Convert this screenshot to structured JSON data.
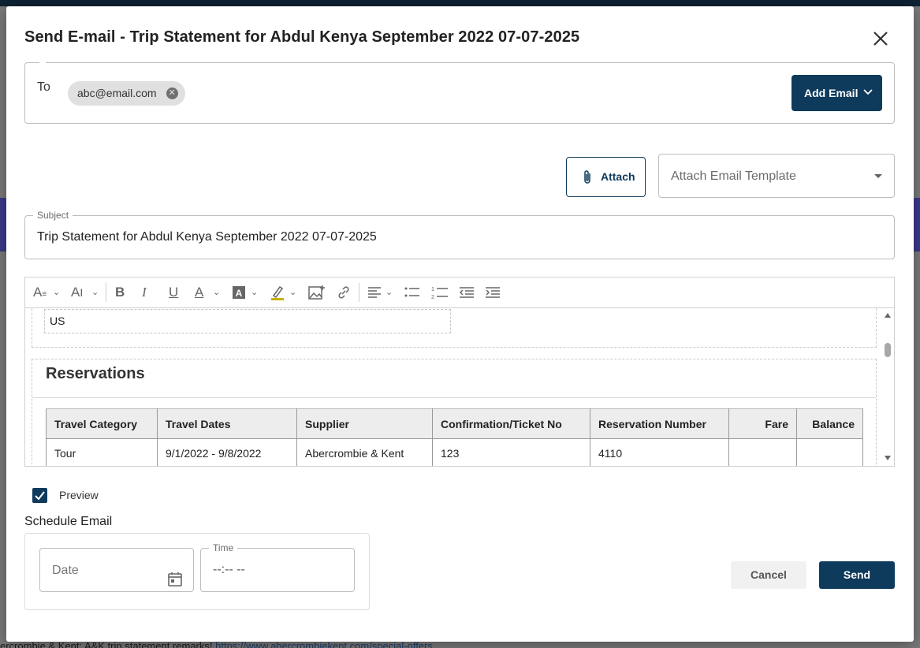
{
  "background": {
    "bottom_text": "ercrombie & Kent: A&K trip statement remarks!",
    "bottom_link": "https://www.abercrombiekent.com/special-offers"
  },
  "dialog": {
    "title": "Send E-mail - Trip Statement for Abdul Kenya September 2022 07-07-2025",
    "to": {
      "label": "To",
      "recipients": [
        "abc@email.com"
      ],
      "add_email_label": "Add Email"
    },
    "attach_label": "Attach",
    "template_placeholder": "Attach Email Template",
    "subject": {
      "label": "Subject",
      "value": "Trip Statement for Abdul Kenya September 2022 07-07-2025"
    },
    "editor": {
      "address_last_line": "US",
      "section_title": "Reservations",
      "table": {
        "headers": [
          "Travel Category",
          "Travel Dates",
          "Supplier",
          "Confirmation/Ticket No",
          "Reservation Number",
          "Fare",
          "Balance"
        ],
        "rows": [
          [
            "Tour",
            "9/1/2022 - 9/8/2022",
            "Abercrombie & Kent",
            "123",
            "4110",
            "",
            ""
          ]
        ]
      }
    },
    "preview": {
      "label": "Preview",
      "checked": true
    },
    "schedule": {
      "label": "Schedule Email",
      "date_placeholder": "Date",
      "time_label": "Time",
      "time_value": "--:-- --"
    },
    "cancel_label": "Cancel",
    "send_label": "Send"
  },
  "colors": {
    "primary": "#0e3a5c",
    "chip_bg": "#e0e0e0",
    "table_header_bg": "#ededed"
  }
}
